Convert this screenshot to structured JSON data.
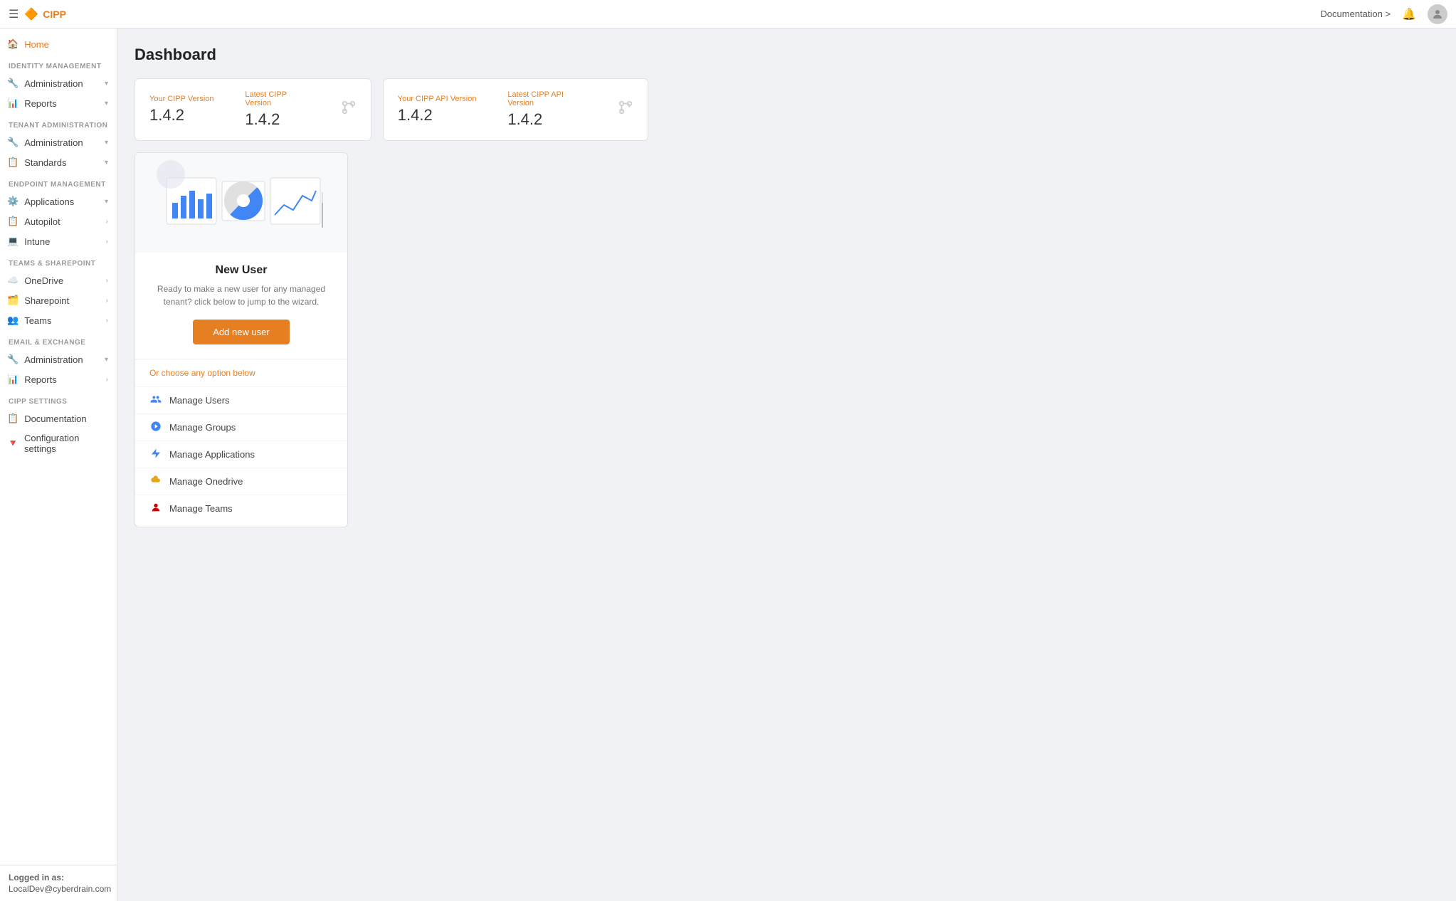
{
  "topbar": {
    "logo_text": "CIPP",
    "hamburger": "☰",
    "doc_label": "Documentation >",
    "bell_label": "🔔",
    "avatar_label": "👤"
  },
  "sidebar": {
    "home_label": "Home",
    "identity_management": {
      "section_label": "IDENTITY MANAGEMENT",
      "items": [
        {
          "label": "Administration",
          "has_chevron": true,
          "icon": "🔧"
        },
        {
          "label": "Reports",
          "has_chevron": true,
          "icon": "📊"
        }
      ]
    },
    "tenant_administration": {
      "section_label": "TENANT ADMINISTRATION",
      "items": [
        {
          "label": "Administration",
          "has_chevron": true,
          "icon": "🔧"
        },
        {
          "label": "Standards",
          "has_chevron": true,
          "icon": "📋"
        }
      ]
    },
    "endpoint_management": {
      "section_label": "ENDPOINT MANAGEMENT",
      "items": [
        {
          "label": "Applications",
          "has_chevron": true,
          "icon": "⚙️"
        },
        {
          "label": "Autopilot",
          "has_chevron": true,
          "icon": "📋"
        },
        {
          "label": "Intune",
          "has_chevron": true,
          "icon": "💻"
        }
      ]
    },
    "teams_sharepoint": {
      "section_label": "TEAMS & SHAREPOINT",
      "items": [
        {
          "label": "OneDrive",
          "has_chevron": true,
          "icon": "☁️"
        },
        {
          "label": "Sharepoint",
          "has_chevron": true,
          "icon": "🗂️"
        },
        {
          "label": "Teams",
          "has_chevron": true,
          "icon": "👥"
        }
      ]
    },
    "email_exchange": {
      "section_label": "EMAIL & EXCHANGE",
      "items": [
        {
          "label": "Administration",
          "has_chevron": true,
          "icon": "🔧"
        },
        {
          "label": "Reports",
          "has_chevron": true,
          "icon": "📊"
        }
      ]
    },
    "cipp_settings": {
      "section_label": "CIPP SETTINGS",
      "items": [
        {
          "label": "Documentation",
          "has_chevron": false,
          "icon": "📋"
        },
        {
          "label": "Configuration settings",
          "has_chevron": false,
          "icon": "🔻"
        }
      ]
    },
    "footer": {
      "logged_in_label": "Logged in as:",
      "email": "LocalDev@cyberdrain.com"
    }
  },
  "main": {
    "page_title": "Dashboard",
    "version_card_1": {
      "your_label": "Your CIPP Version",
      "your_value": "1.4.2",
      "latest_label": "Latest CIPP Version",
      "latest_value": "1.4.2"
    },
    "version_card_2": {
      "your_label": "Your CIPP API Version",
      "your_value": "1.4.2",
      "latest_label": "Latest CIPP API Version",
      "latest_value": "1.4.2"
    },
    "new_user_card": {
      "title": "New User",
      "description": "Ready to make a new user for any managed tenant? click below to jump to the wizard.",
      "button_label": "Add new user",
      "options_label": "Or choose any option below",
      "options": [
        {
          "label": "Manage Users",
          "icon_class": "option-icon-users"
        },
        {
          "label": "Manage Groups",
          "icon_class": "option-icon-groups"
        },
        {
          "label": "Manage Applications",
          "icon_class": "option-icon-apps"
        },
        {
          "label": "Manage Onedrive",
          "icon_class": "option-icon-onedrive"
        },
        {
          "label": "Manage Teams",
          "icon_class": "option-icon-teams"
        }
      ]
    }
  }
}
